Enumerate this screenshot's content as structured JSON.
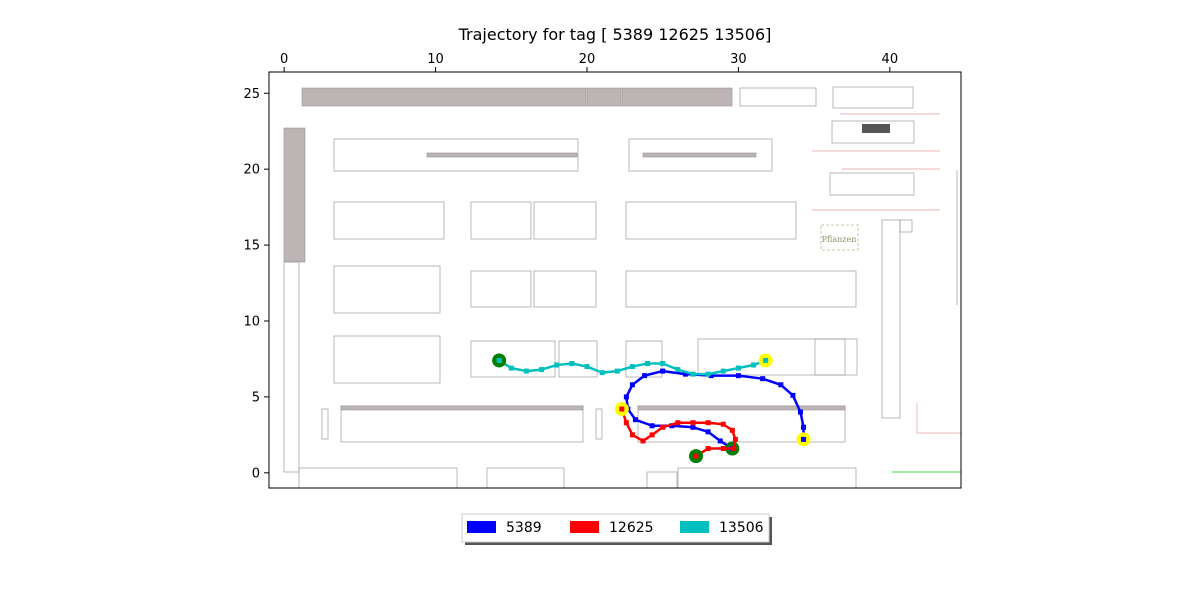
{
  "chart_data": {
    "type": "line",
    "title": "Trajectory for tag [ 5389 12625 13506]",
    "xlabel": "",
    "ylabel": "",
    "xlim": [
      -1.0,
      44.7
    ],
    "ylim": [
      26.4,
      -1.0
    ],
    "x_axis_position": "top",
    "y_inverted": true,
    "grid": false,
    "xticks": [
      0,
      10,
      20,
      30,
      40
    ],
    "yticks": [
      0,
      5,
      10,
      15,
      20,
      25
    ],
    "legend_position": "bottom-center",
    "background": "floor-plan",
    "background_label": "Pflanzen",
    "series": [
      {
        "name": "5389",
        "color": "#0000ff",
        "start": [
          29.6,
          1.6
        ],
        "end": [
          34.3,
          2.2
        ],
        "x": [
          29.6,
          28.8,
          28.0,
          27.0,
          25.6,
          24.3,
          23.2,
          22.7,
          22.6,
          23.0,
          23.8,
          25.0,
          26.5,
          28.2,
          30.0,
          31.6,
          32.8,
          33.6,
          34.1,
          34.3,
          34.3
        ],
        "y": [
          1.6,
          2.1,
          2.7,
          3.0,
          3.1,
          3.1,
          3.5,
          4.2,
          5.0,
          5.8,
          6.4,
          6.7,
          6.5,
          6.4,
          6.4,
          6.2,
          5.8,
          5.1,
          4.0,
          3.0,
          2.2
        ]
      },
      {
        "name": "12625",
        "color": "#ff0000",
        "start": [
          27.2,
          1.1
        ],
        "end": [
          22.3,
          4.2
        ],
        "x": [
          27.2,
          28.0,
          29.0,
          29.7,
          29.8,
          29.6,
          29.0,
          28.0,
          27.0,
          26.0,
          25.0,
          24.3,
          23.7,
          23.0,
          22.6,
          22.3
        ],
        "y": [
          1.1,
          1.6,
          1.6,
          1.6,
          2.2,
          2.8,
          3.2,
          3.3,
          3.3,
          3.3,
          3.0,
          2.5,
          2.1,
          2.5,
          3.3,
          4.2
        ]
      },
      {
        "name": "13506",
        "color": "#00bfbf",
        "start": [
          14.2,
          7.4
        ],
        "end": [
          31.8,
          7.4
        ],
        "x": [
          14.2,
          15.0,
          16.0,
          17.0,
          18.0,
          19.0,
          20.0,
          21.0,
          22.0,
          23.0,
          24.0,
          25.0,
          26.0,
          27.0,
          28.0,
          29.0,
          30.0,
          31.0,
          31.8
        ],
        "y": [
          7.4,
          6.9,
          6.7,
          6.8,
          7.1,
          7.2,
          7.0,
          6.6,
          6.7,
          7.0,
          7.2,
          7.2,
          6.8,
          6.5,
          6.5,
          6.7,
          6.9,
          7.1,
          7.4
        ]
      }
    ]
  }
}
